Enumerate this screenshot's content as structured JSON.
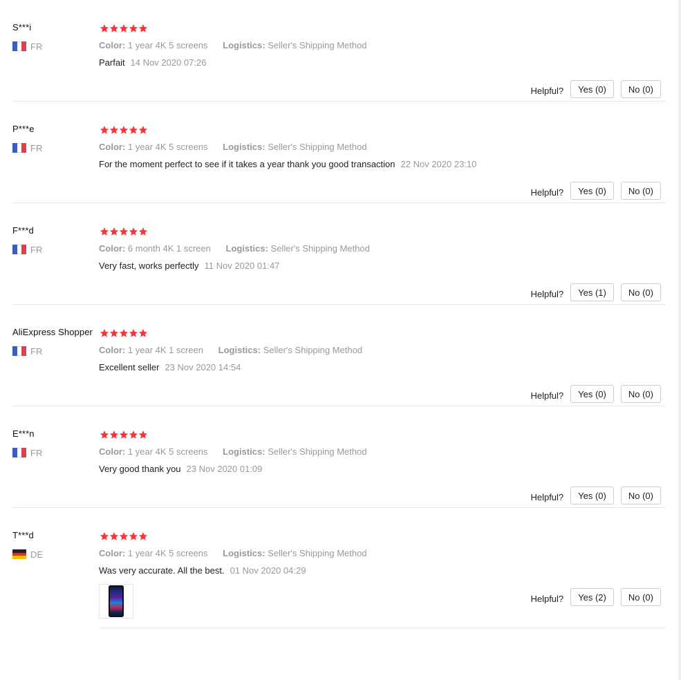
{
  "reviews": [
    {
      "user": "S***i",
      "country": "FR",
      "color_label": "Color:",
      "color": "1 year 4K 5 screens",
      "logistics_label": "Logistics:",
      "logistics": "Seller's Shipping Method",
      "text": "Parfait",
      "date": "14 Nov 2020 07:26",
      "helpful_label": "Helpful?",
      "yes": "Yes (0)",
      "no": "No (0)"
    },
    {
      "user": "P***e",
      "country": "FR",
      "color_label": "Color:",
      "color": "1 year 4K 5 screens",
      "logistics_label": "Logistics:",
      "logistics": "Seller's Shipping Method",
      "text": "For the moment perfect to see if it takes a year thank you good transaction",
      "date": "22 Nov 2020 23:10",
      "helpful_label": "Helpful?",
      "yes": "Yes (0)",
      "no": "No (0)"
    },
    {
      "user": "F***d",
      "country": "FR",
      "color_label": "Color:",
      "color": "6 month 4K 1 screen",
      "logistics_label": "Logistics:",
      "logistics": "Seller's Shipping Method",
      "text": "Very fast, works perfectly",
      "date": "11 Nov 2020 01:47",
      "helpful_label": "Helpful?",
      "yes": "Yes (1)",
      "no": "No (0)"
    },
    {
      "user": "AliExpress Shopper",
      "country": "FR",
      "color_label": "Color:",
      "color": "1 year 4K 1 screen",
      "logistics_label": "Logistics:",
      "logistics": "Seller's Shipping Method",
      "text": "Excellent seller",
      "date": "23 Nov 2020 14:54",
      "helpful_label": "Helpful?",
      "yes": "Yes (0)",
      "no": "No (0)"
    },
    {
      "user": "E***n",
      "country": "FR",
      "color_label": "Color:",
      "color": "1 year 4K 5 screens",
      "logistics_label": "Logistics:",
      "logistics": "Seller's Shipping Method",
      "text": "Very good thank you",
      "date": "23 Nov 2020 01:09",
      "helpful_label": "Helpful?",
      "yes": "Yes (0)",
      "no": "No (0)"
    },
    {
      "user": "T***d",
      "country": "DE",
      "color_label": "Color:",
      "color": "1 year 4K 5 screens",
      "logistics_label": "Logistics:",
      "logistics": "Seller's Shipping Method",
      "text": "Was very accurate. All the best.",
      "date": "01 Nov 2020 04:29",
      "helpful_label": "Helpful?",
      "yes": "Yes (2)",
      "no": "No (0)"
    }
  ],
  "rating_stars": 5,
  "colors": {
    "star": "#f5373c",
    "muted": "#999999",
    "divider": "#e6e6e6"
  },
  "icons": {
    "star": "star-icon",
    "flag_fr": "france-flag-icon",
    "flag_de": "germany-flag-icon"
  }
}
